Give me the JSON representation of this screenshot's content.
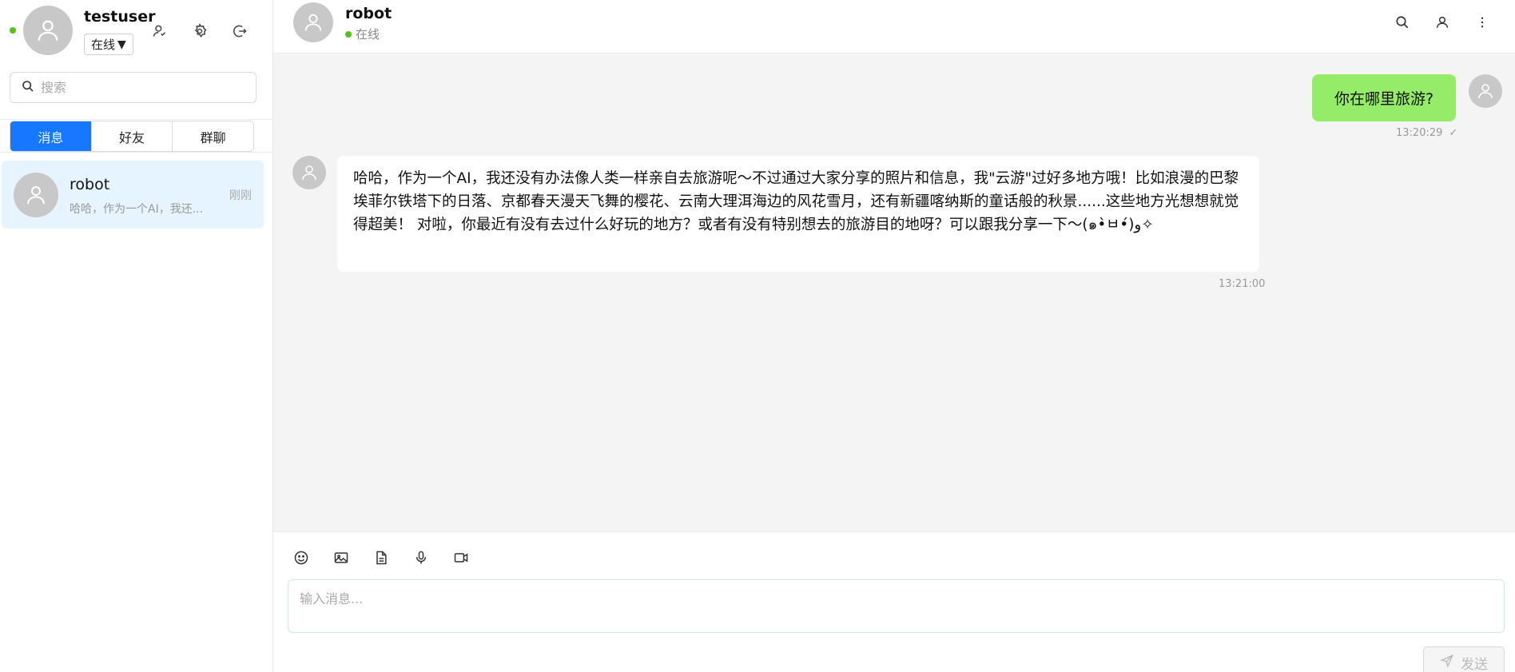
{
  "user": {
    "name": "testuser",
    "status": "在线",
    "status_caret": "▼"
  },
  "search": {
    "placeholder": "搜索"
  },
  "tabs": [
    {
      "label": "消息",
      "active": true
    },
    {
      "label": "好友",
      "active": false
    },
    {
      "label": "群聊",
      "active": false
    }
  ],
  "conversations": [
    {
      "name": "robot",
      "preview": "哈哈，作为一个AI，我还...",
      "time": "刚刚",
      "selected": true
    }
  ],
  "chat": {
    "peer_name": "robot",
    "peer_status": "在线",
    "messages": [
      {
        "direction": "out",
        "text": "你在哪里旅游?",
        "time": "13:20:29",
        "read_mark": "✓"
      },
      {
        "direction": "in",
        "text": "哈哈，作为一个AI，我还没有办法像人类一样亲自去旅游呢～不过通过大家分享的照片和信息，我\"云游\"过好多地方哦！比如浪漫的巴黎埃菲尔铁塔下的日落、京都春天漫天飞舞的樱花、云南大理洱海边的风花雪月，还有新疆喀纳斯的童话般的秋景......这些地方光想想就觉得超美！ 对啦，你最近有没有去过什么好玩的地方？或者有没有特别想去的旅游目的地呀？可以跟我分享一下～(๑•̀ㅂ•́)و✧",
        "time": "13:21:00"
      }
    ]
  },
  "composer": {
    "placeholder": "输入消息...",
    "send_label": "发送",
    "tools": [
      "emoji-icon",
      "image-icon",
      "file-icon",
      "microphone-icon",
      "video-icon"
    ]
  },
  "colors": {
    "accent": "#1677ff",
    "online": "#52c41a",
    "bubble_out": "#95ec69",
    "selected_row": "#e6f4ff",
    "chat_bg": "#f4f4f4"
  }
}
